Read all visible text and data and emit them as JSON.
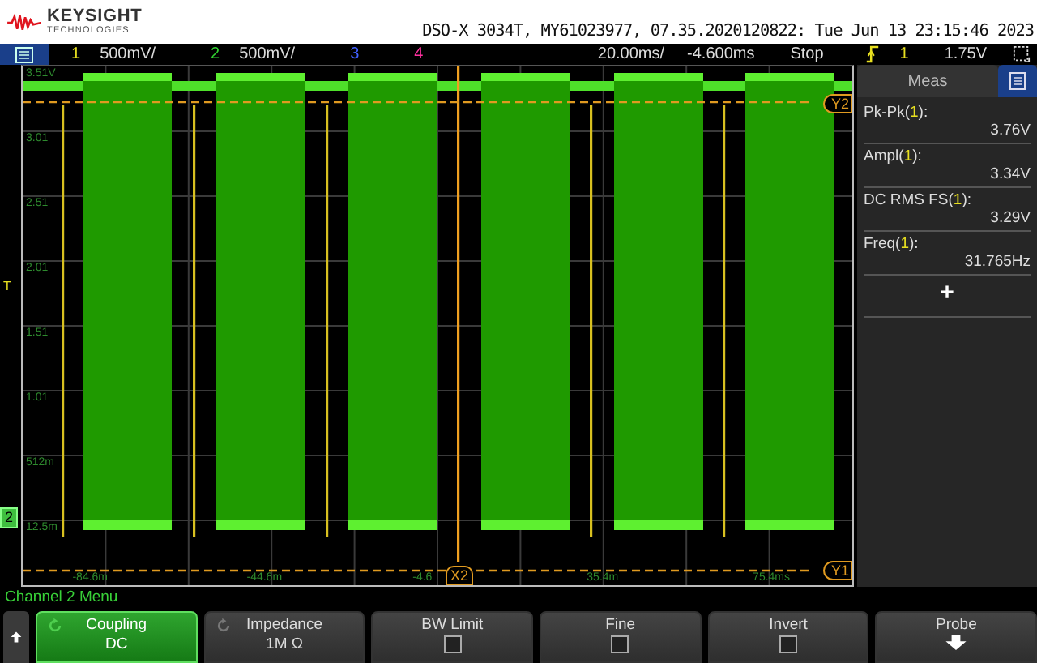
{
  "header": {
    "brand": "KEYSIGHT",
    "brand_sub": "TECHNOLOGIES",
    "title": "DSO-X 3034T, MY61023977, 07.35.2020120822: Tue Jun 13 23:15:46 2023"
  },
  "status_bar": {
    "channels": [
      {
        "number": "1",
        "scale": "500mV/",
        "color": "#e8e020"
      },
      {
        "number": "2",
        "scale": "500mV/",
        "color": "#30d030"
      },
      {
        "number": "3",
        "color": "#4060ff"
      },
      {
        "number": "4",
        "color": "#ff30a0"
      }
    ],
    "timebase": "20.00ms/",
    "delay": "-4.600ms",
    "run_state": "Stop",
    "trigger_source": "1",
    "trigger_level": "1.75V"
  },
  "plot": {
    "y_labels": [
      "3.51V",
      "3.01",
      "2.51",
      "2.01",
      "1.51",
      "1.01",
      "512m",
      "12.5m"
    ],
    "x_labels": [
      "-84.6m",
      "-44.6m",
      "-4.6",
      "35.4m",
      "75.4ms"
    ],
    "trigger_marker": "T",
    "ground_marker": "2",
    "cursor_x": "X2",
    "cursor_y_top": "Y2",
    "cursor_y_bottom": "Y1"
  },
  "measurements": {
    "title": "Meas",
    "items": [
      {
        "name": "Pk-Pk(",
        "source": "1",
        "name_end": "):",
        "value": "3.76V"
      },
      {
        "name": "Ampl(",
        "source": "1",
        "name_end": "):",
        "value": "3.34V"
      },
      {
        "name": "DC RMS FS(",
        "source": "1",
        "name_end": "):",
        "value": "3.29V"
      },
      {
        "name": "Freq(",
        "source": "1",
        "name_end": "):",
        "value": "31.765Hz"
      }
    ],
    "add_button": "+"
  },
  "menu": {
    "title": "Channel 2 Menu",
    "softkeys": [
      {
        "kind": "value",
        "label": "Coupling",
        "value": "DC",
        "selected": true
      },
      {
        "kind": "value",
        "label": "Impedance",
        "value": "1M Ω",
        "selected": false
      },
      {
        "kind": "checkbox",
        "label": "BW Limit",
        "checked": false,
        "selected": false
      },
      {
        "kind": "checkbox",
        "label": "Fine",
        "checked": false,
        "selected": false
      },
      {
        "kind": "checkbox",
        "label": "Invert",
        "checked": false,
        "selected": false
      },
      {
        "kind": "submenu",
        "label": "Probe",
        "selected": false
      }
    ]
  }
}
